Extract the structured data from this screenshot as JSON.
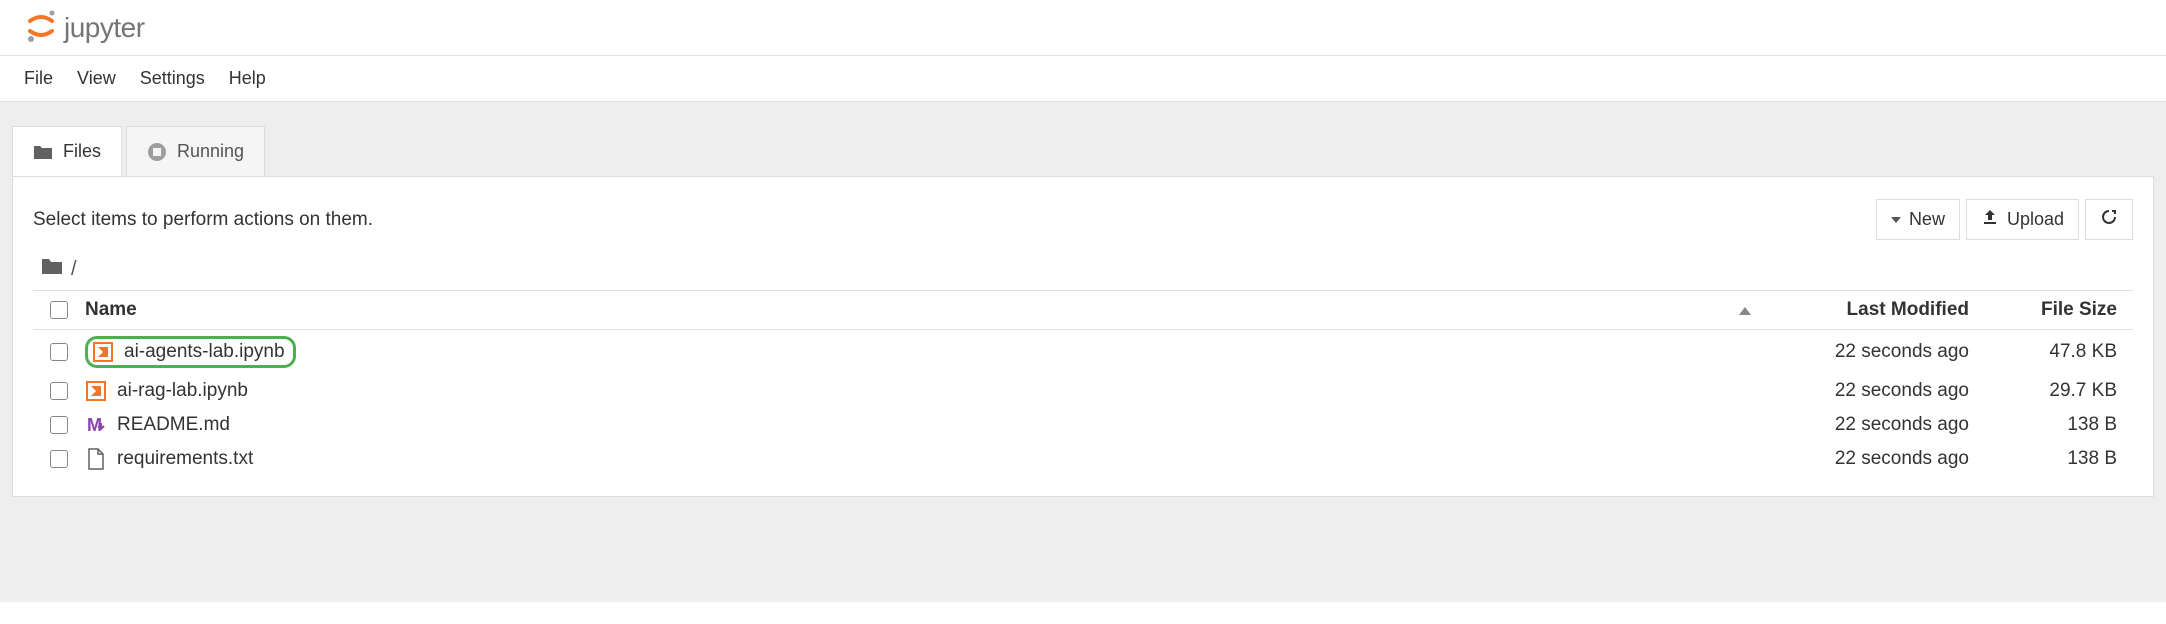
{
  "logo_text": "jupyter",
  "menu": {
    "file": "File",
    "view": "View",
    "settings": "Settings",
    "help": "Help"
  },
  "tabs": {
    "files": "Files",
    "running": "Running"
  },
  "toolbar": {
    "hint": "Select items to perform actions on them.",
    "new": "New",
    "upload": "Upload"
  },
  "breadcrumb": {
    "root": "/"
  },
  "columns": {
    "name": "Name",
    "modified": "Last Modified",
    "size": "File Size"
  },
  "files": [
    {
      "name": "ai-agents-lab.ipynb",
      "modified": "22 seconds ago",
      "size": "47.8 KB",
      "icon": "notebook",
      "highlighted": true
    },
    {
      "name": "ai-rag-lab.ipynb",
      "modified": "22 seconds ago",
      "size": "29.7 KB",
      "icon": "notebook",
      "highlighted": false
    },
    {
      "name": "README.md",
      "modified": "22 seconds ago",
      "size": "138 B",
      "icon": "markdown",
      "highlighted": false
    },
    {
      "name": "requirements.txt",
      "modified": "22 seconds ago",
      "size": "138 B",
      "icon": "file",
      "highlighted": false
    }
  ]
}
